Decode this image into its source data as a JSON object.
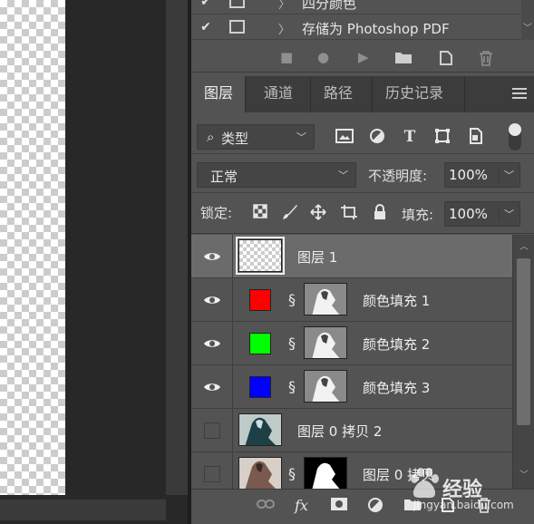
{
  "actions": {
    "rows": [
      {
        "checked": true,
        "label": "四分颜色",
        "arrow": "〉"
      },
      {
        "checked": true,
        "label": "存储为 Photoshop PDF",
        "arrow": "〉"
      }
    ],
    "toolbar_icons": [
      "stop-icon",
      "record-icon",
      "play-icon",
      "new-set-icon",
      "new-action-icon",
      "trash-icon"
    ]
  },
  "tabs": [
    {
      "label": "图层",
      "active": true
    },
    {
      "label": "通道",
      "active": false
    },
    {
      "label": "路径",
      "active": false
    },
    {
      "label": "历史记录",
      "active": false
    }
  ],
  "filter": {
    "kind_label": "类型",
    "icons": [
      "pixel-layer-filter-icon",
      "adjustment-layer-filter-icon",
      "type-layer-filter-icon",
      "shape-layer-filter-icon",
      "smart-object-filter-icon"
    ]
  },
  "blend": {
    "mode": "正常",
    "opacity_label": "不透明度:",
    "opacity_value": "100%"
  },
  "lock": {
    "label": "锁定:",
    "icons": [
      "lock-transparent-pixels-icon",
      "lock-image-pixels-icon",
      "lock-position-icon",
      "lock-artboard-icon",
      "lock-all-icon"
    ],
    "fill_label": "填充:",
    "fill_value": "100%"
  },
  "layers": [
    {
      "name": "图层 1",
      "visible": true,
      "selected": true,
      "type": "empty"
    },
    {
      "name": "颜色填充 1",
      "visible": true,
      "selected": false,
      "type": "fill",
      "color": "#ff0000"
    },
    {
      "name": "颜色填充 2",
      "visible": true,
      "selected": false,
      "type": "fill",
      "color": "#00ff00"
    },
    {
      "name": "颜色填充 3",
      "visible": true,
      "selected": false,
      "type": "fill",
      "color": "#0000ff"
    },
    {
      "name": "图层 0 拷贝 2",
      "visible": false,
      "selected": false,
      "type": "photo-inverted"
    },
    {
      "name": "图层 0 拷贝",
      "visible": false,
      "selected": false,
      "type": "photo-masked"
    }
  ],
  "layers_toolbar_icons": [
    "link-layers-icon",
    "layer-style-icon",
    "layer-mask-icon",
    "adjustment-layer-icon",
    "group-icon",
    "new-layer-icon",
    "delete-layer-icon"
  ],
  "layers_toolbar_fx": "fx",
  "watermark": {
    "brand": "经验",
    "url": "jingyan.baidu.com"
  }
}
